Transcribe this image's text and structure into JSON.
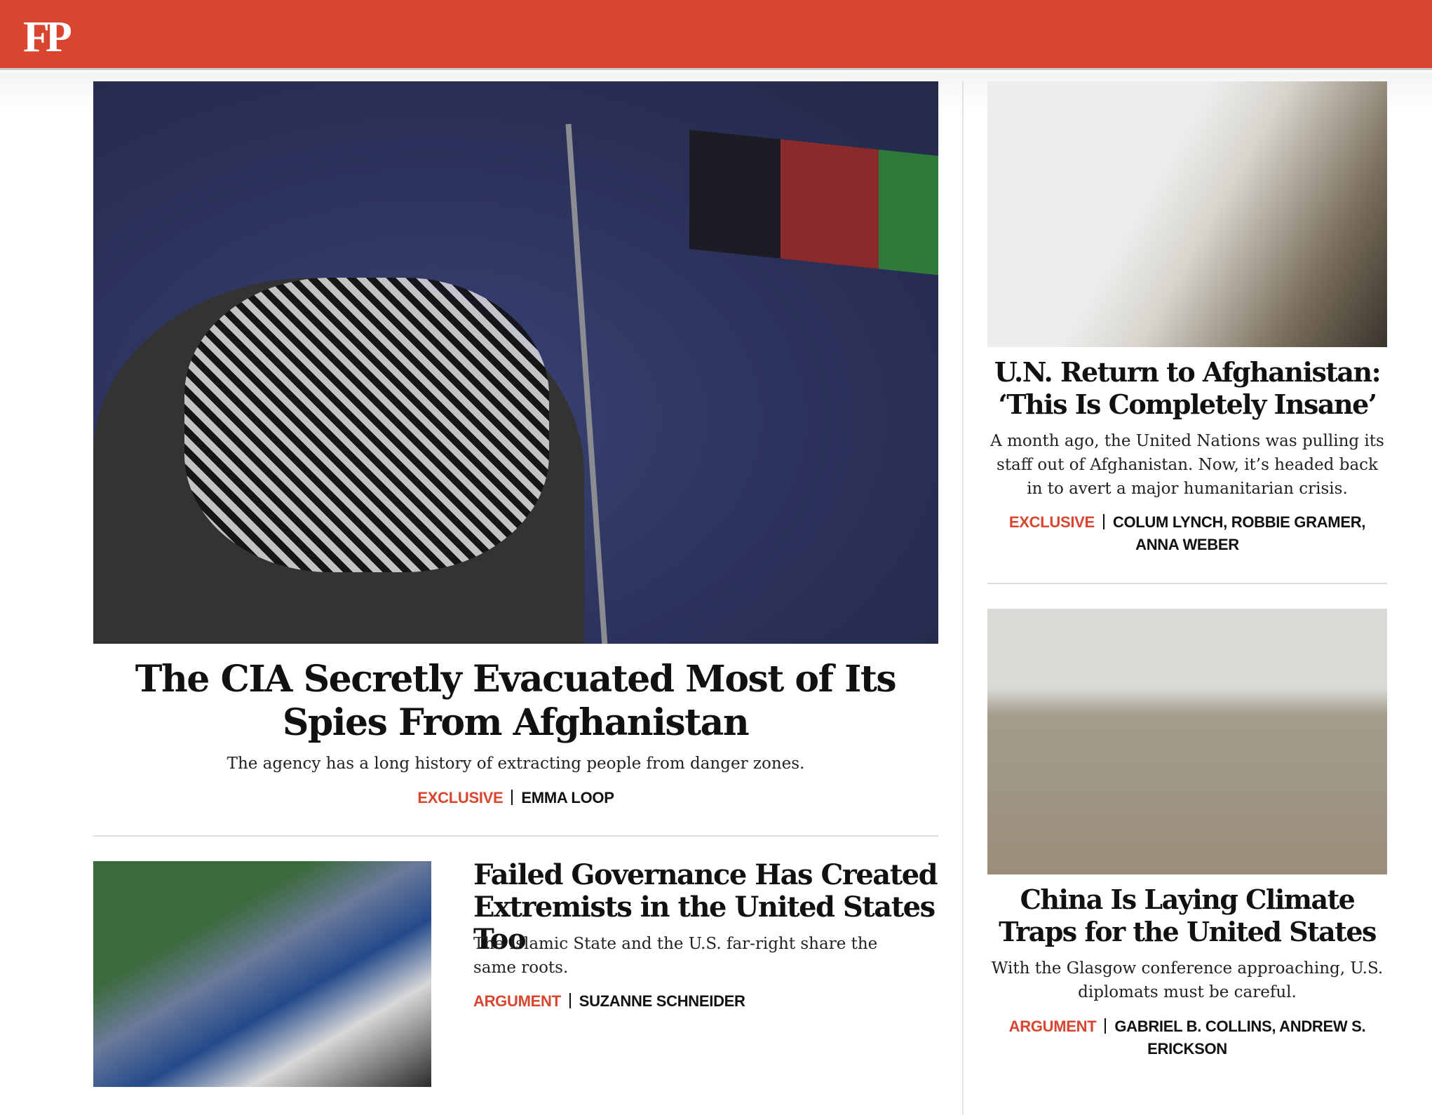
{
  "site": {
    "logo": "FP"
  },
  "lead": {
    "headline": "The CIA Secretly Evacuated Most of Its Spies From Afghanistan",
    "dek": "The agency has a long history of extracting people from danger zones.",
    "tag": "Exclusive",
    "author": "Emma Loop"
  },
  "secondary": {
    "headline": "Failed Governance Has Created Extremists in the United States Too",
    "dek": "The Islamic State and the U.S. far-right share the same roots.",
    "tag": "Argument",
    "author": "Suzanne Schneider"
  },
  "side": [
    {
      "headline": "U.N. Return to Afghanistan: ‘This Is Completely Insane’",
      "dek": "A month ago, the United Nations was pulling its staff out of Afghanistan. Now, it’s headed back in to avert a major humanitarian crisis.",
      "tag": "Exclusive",
      "author": "Colum Lynch, Robbie Gramer, Anna Weber"
    },
    {
      "headline": "China Is Laying Climate Traps for the United States",
      "dek": "With the Glasgow conference approaching, U.S. diplomats must be careful.",
      "tag": "Argument",
      "author": "Gabriel B. Collins, Andrew S. Erickson"
    }
  ],
  "colors": {
    "brand": "#d9452f"
  }
}
